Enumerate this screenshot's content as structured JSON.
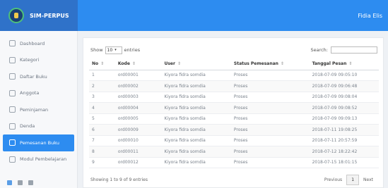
{
  "header": {
    "brand": "SIM-PERPUS",
    "user": "Fidia Elis"
  },
  "sidebar": {
    "items": [
      {
        "label": "Dashboard",
        "icon": "dashboard-icon"
      },
      {
        "label": "Kategori",
        "icon": "category-icon"
      },
      {
        "label": "Daftar Buku",
        "icon": "book-list-icon"
      },
      {
        "label": "Anggota",
        "icon": "members-icon"
      },
      {
        "label": "Peminjaman",
        "icon": "loan-icon"
      },
      {
        "label": "Denda",
        "icon": "fine-icon"
      },
      {
        "label": "Pemesanan Buku",
        "icon": "order-icon",
        "active": true
      },
      {
        "label": "Modul Pembelajaran",
        "icon": "module-icon"
      }
    ]
  },
  "table_controls": {
    "show": "Show",
    "length": "10",
    "entries": "entries",
    "search": "Search:"
  },
  "table": {
    "headers": [
      "No",
      "Kode",
      "User",
      "Status Pemesanan",
      "Tanggal Pesan"
    ],
    "rows": [
      [
        "1",
        "ord00001",
        "Kiyora fidra somdia",
        "Proses",
        "2018-07-09 09:05:10"
      ],
      [
        "2",
        "ord00002",
        "Kiyora fidra somdia",
        "Proses",
        "2018-07-09 09:06:48"
      ],
      [
        "3",
        "ord00003",
        "Kiyora fidra somdia",
        "Proses",
        "2018-07-09 09:08:04"
      ],
      [
        "4",
        "ord00004",
        "Kiyora fidra somdia",
        "Proses",
        "2018-07-09 09:08:52"
      ],
      [
        "5",
        "ord00005",
        "Kiyora fidra somdia",
        "Proses",
        "2018-07-09 09:09:13"
      ],
      [
        "6",
        "ord00009",
        "Kiyora fidra somdia",
        "Proses",
        "2018-07-11 19:08:25"
      ],
      [
        "7",
        "ord00010",
        "Kiyora fidra somdia",
        "Proses",
        "2018-07-11 20:57:59"
      ],
      [
        "8",
        "ord00011",
        "Kiyora fidra somdia",
        "Proses",
        "2018-07-12 18:22:42"
      ],
      [
        "9",
        "ord00012",
        "Kiyora fidra somdia",
        "Proses",
        "2018-07-15 18:01:15"
      ]
    ]
  },
  "footer": {
    "info": "Showing 1 to 9 of 9 entries",
    "previous": "Previous",
    "page": "1",
    "next": "Next"
  }
}
